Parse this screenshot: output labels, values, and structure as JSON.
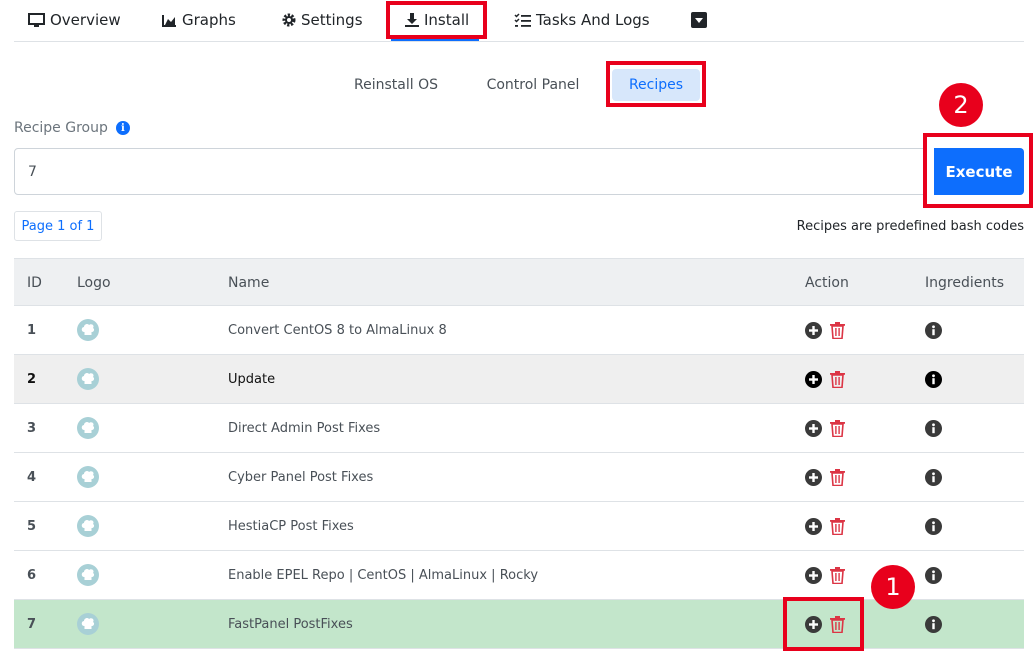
{
  "nav": {
    "tabs": [
      {
        "label": "Overview",
        "icon": "monitor-icon"
      },
      {
        "label": "Graphs",
        "icon": "area-chart-icon"
      },
      {
        "label": "Settings",
        "icon": "gear-icon"
      },
      {
        "label": "Install",
        "icon": "download-icon",
        "active": true
      },
      {
        "label": "Tasks And Logs",
        "icon": "tasks-list-icon"
      }
    ],
    "more_icon": "caret-down-square-icon"
  },
  "subtabs": [
    {
      "label": "Reinstall OS"
    },
    {
      "label": "Control Panel"
    },
    {
      "label": "Recipes",
      "active": true
    }
  ],
  "recipe_group": {
    "label": "Recipe Group",
    "value": "7",
    "execute_label": "Execute"
  },
  "pagination": {
    "label": "Page 1 of 1"
  },
  "hint": "Recipes are predefined bash codes",
  "table": {
    "headers": {
      "id": "ID",
      "logo": "Logo",
      "name": "Name",
      "action": "Action",
      "ingredients": "Ingredients"
    },
    "rows": [
      {
        "id": "1",
        "name": "Convert CentOS 8 to AlmaLinux 8"
      },
      {
        "id": "2",
        "name": "Update"
      },
      {
        "id": "3",
        "name": "Direct Admin Post Fixes"
      },
      {
        "id": "4",
        "name": "Cyber Panel Post Fixes"
      },
      {
        "id": "5",
        "name": "HestiaCP Post Fixes"
      },
      {
        "id": "6",
        "name": "Enable EPEL Repo | CentOS | AlmaLinux | Rocky"
      },
      {
        "id": "7",
        "name": "FastPanel PostFixes",
        "selected": true
      }
    ]
  },
  "annotations": {
    "marker_1": "1",
    "marker_2": "2"
  },
  "colors": {
    "accent": "#0d6efd",
    "annotation": "#e8001c",
    "selected_row": "#c3e6cb",
    "delete": "#dc3545"
  }
}
